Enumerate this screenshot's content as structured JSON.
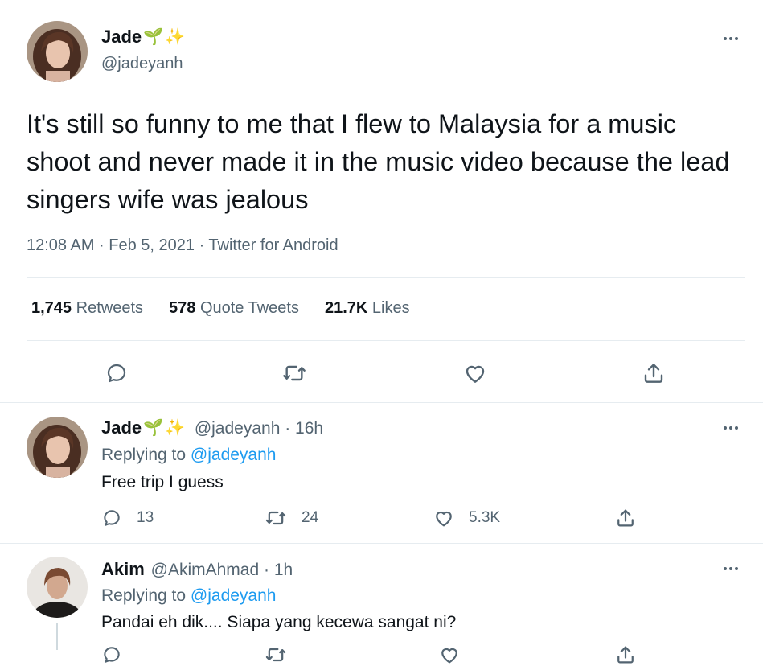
{
  "main_tweet": {
    "display_name": "Jade",
    "emoji_1": "🌱",
    "emoji_2": "✨",
    "handle": "@jadeyanh",
    "text": "It's still so funny to me that I flew to Malaysia for a music shoot and never made it in the music video because the lead singers wife was jealous",
    "meta": "12:08 AM · Feb 5, 2021 · Twitter for Android",
    "stats": {
      "retweets_count": "1,745",
      "retweets_label": "Retweets",
      "quotes_count": "578",
      "quotes_label": "Quote Tweets",
      "likes_count": "21.7K",
      "likes_label": "Likes"
    },
    "actions": [
      "reply-icon",
      "retweet-icon",
      "like-icon",
      "share-icon"
    ]
  },
  "replies": [
    {
      "display_name": "Jade",
      "emoji_1": "🌱",
      "emoji_2": "✨",
      "handle_time": "@jadeyanh · 16h",
      "replying_prefix": "Replying to",
      "replying_handle": "@jadeyanh",
      "text": "Free trip I guess",
      "reply_count": "13",
      "retweet_count": "24",
      "like_count": "5.3K"
    },
    {
      "display_name": "Akim",
      "handle_time": "@AkimAhmad · 1h",
      "replying_prefix": "Replying to",
      "replying_handle": "@jadeyanh",
      "text": "Pandai eh dik.... Siapa yang kecewa sangat ni?"
    }
  ],
  "colors": {
    "accent": "#1d9bf0",
    "muted": "#536471",
    "divider": "#e6ecf0"
  }
}
